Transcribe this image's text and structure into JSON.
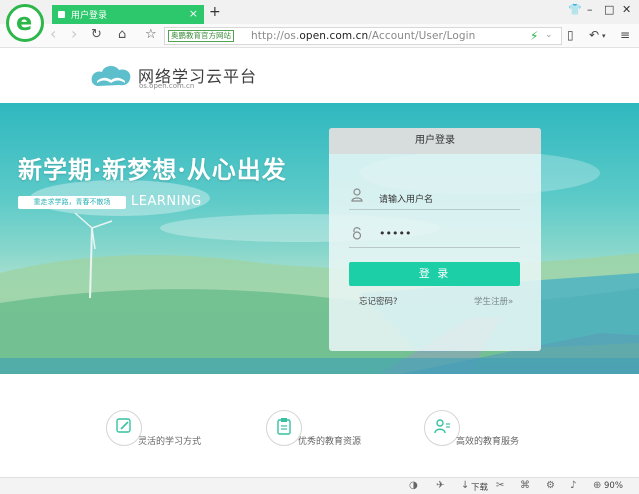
{
  "browser": {
    "tab_title": "用户登录",
    "tab_close": "×",
    "new_tab": "+",
    "window_controls": {
      "shirt": "👕",
      "minimize": "–",
      "maximize": "□",
      "close": "✕"
    },
    "nav": {
      "back": "‹",
      "forward": "›",
      "reload": "↻",
      "home": "⌂",
      "star": "☆"
    },
    "address": {
      "site_badge": "奥鹏教育官方网站",
      "url_prefix": "http://os.",
      "url_host": "open.com.cn",
      "url_path": "/Account/User/Login"
    },
    "right_tools": {
      "phone": "▯",
      "undo": "↶",
      "menu": "≡"
    }
  },
  "site": {
    "name": "网络学习云平台",
    "domain": "os.open.com.cn"
  },
  "banner": {
    "slogan": "新学期·新梦想·从心出发",
    "sub_pill": "重走求学路，青春不散场",
    "learning": "LEARNING"
  },
  "login": {
    "header": "用户登录",
    "username_placeholder": "请输入用户名",
    "password_value": "•••••",
    "submit_label": "登 录",
    "forgot": "忘记密码?",
    "register": "学生注册»"
  },
  "features": [
    {
      "label": "灵活的学习方式",
      "icon": "edit-icon"
    },
    {
      "label": "优秀的教育资源",
      "icon": "clipboard-icon"
    },
    {
      "label": "高效的教育服务",
      "icon": "user-service-icon"
    }
  ],
  "statusbar": {
    "download": "下载",
    "zoom": "90%"
  },
  "colors": {
    "accent": "#1ccfa6",
    "tab_green": "#2cc86b",
    "banner_teal": "#2fb8bf"
  }
}
